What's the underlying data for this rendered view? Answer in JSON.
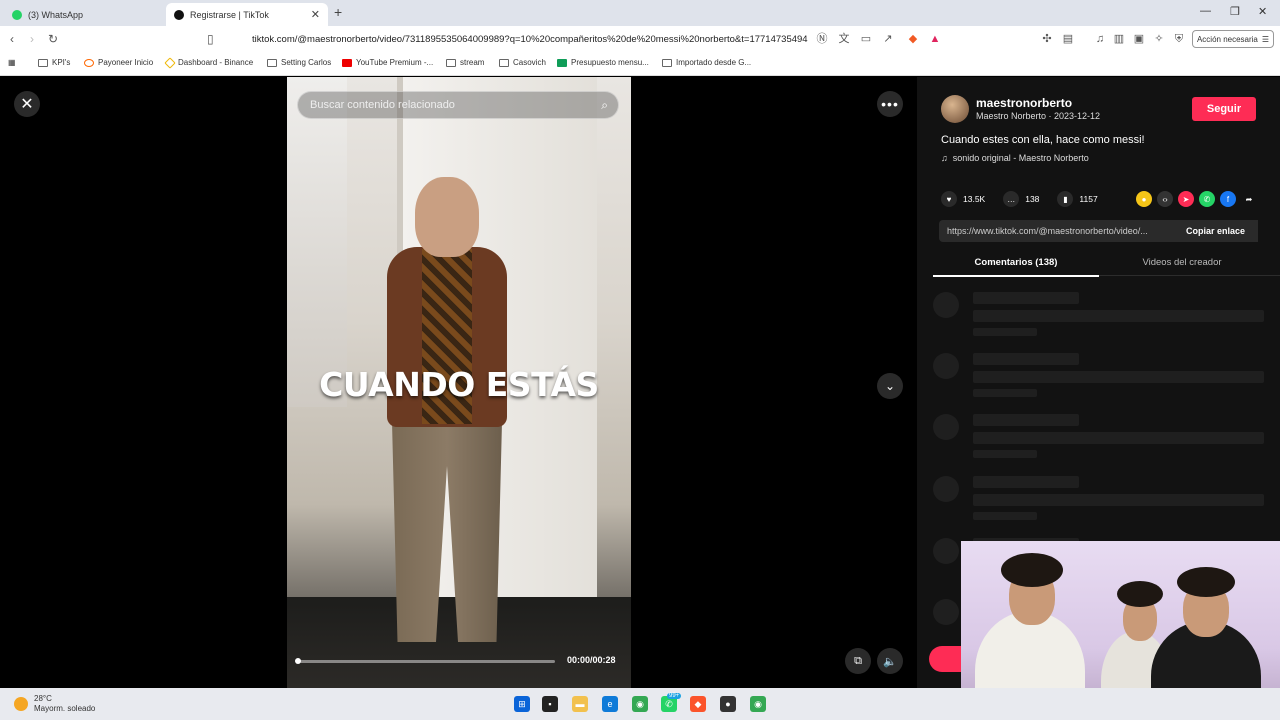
{
  "browser": {
    "tabs": [
      {
        "title": "(3) WhatsApp",
        "active": false,
        "favicon_color": "#25d366"
      },
      {
        "title": "Registrarse | TikTok",
        "active": true,
        "favicon_color": "#111111"
      }
    ],
    "url": "tiktok.com/@maestronorberto/video/7311895535064009989?q=10%20compañeritos%20de%20messi%20norberto&t=17714735494...",
    "action_button": "Acción necesaria",
    "bookmarks": [
      {
        "label": "KPI's",
        "icon": "folder-icon"
      },
      {
        "label": "Payoneer Inicio",
        "icon": "payoneer-icon"
      },
      {
        "label": "Dashboard - Binance",
        "icon": "binance-icon"
      },
      {
        "label": "Setting Carlos",
        "icon": "folder-icon"
      },
      {
        "label": "YouTube Premium -...",
        "icon": "youtube-icon"
      },
      {
        "label": "stream",
        "icon": "folder-icon"
      },
      {
        "label": "Casovich",
        "icon": "folder-icon"
      },
      {
        "label": "Presupuesto mensu...",
        "icon": "sheets-icon"
      },
      {
        "label": "Importado desde G...",
        "icon": "folder-icon"
      }
    ]
  },
  "video": {
    "search_placeholder": "Buscar contenido relacionado",
    "caption": "CUANDO ESTÁS",
    "time": "00:00/00:28",
    "progress": 0.01
  },
  "panel": {
    "username": "maestronorberto",
    "subtitle": "Maestro Norberto · 2023-12-12",
    "follow_label": "Seguir",
    "description": "Cuando estes con ella, hace como messi!",
    "music": "sonido original - Maestro Norberto",
    "likes": "13.5K",
    "comments": "138",
    "saves": "1157",
    "link": "https://www.tiktok.com/@maestronorberto/video/...",
    "copy_label": "Copiar enlace",
    "tab_comments": "Comentarios (138)",
    "tab_videos": "Videos del creador",
    "accent": "#fe2c55"
  },
  "taskbar": {
    "temperature": "28°C",
    "weather": "Mayorm. soleado",
    "whatsapp_badge": "99+"
  }
}
